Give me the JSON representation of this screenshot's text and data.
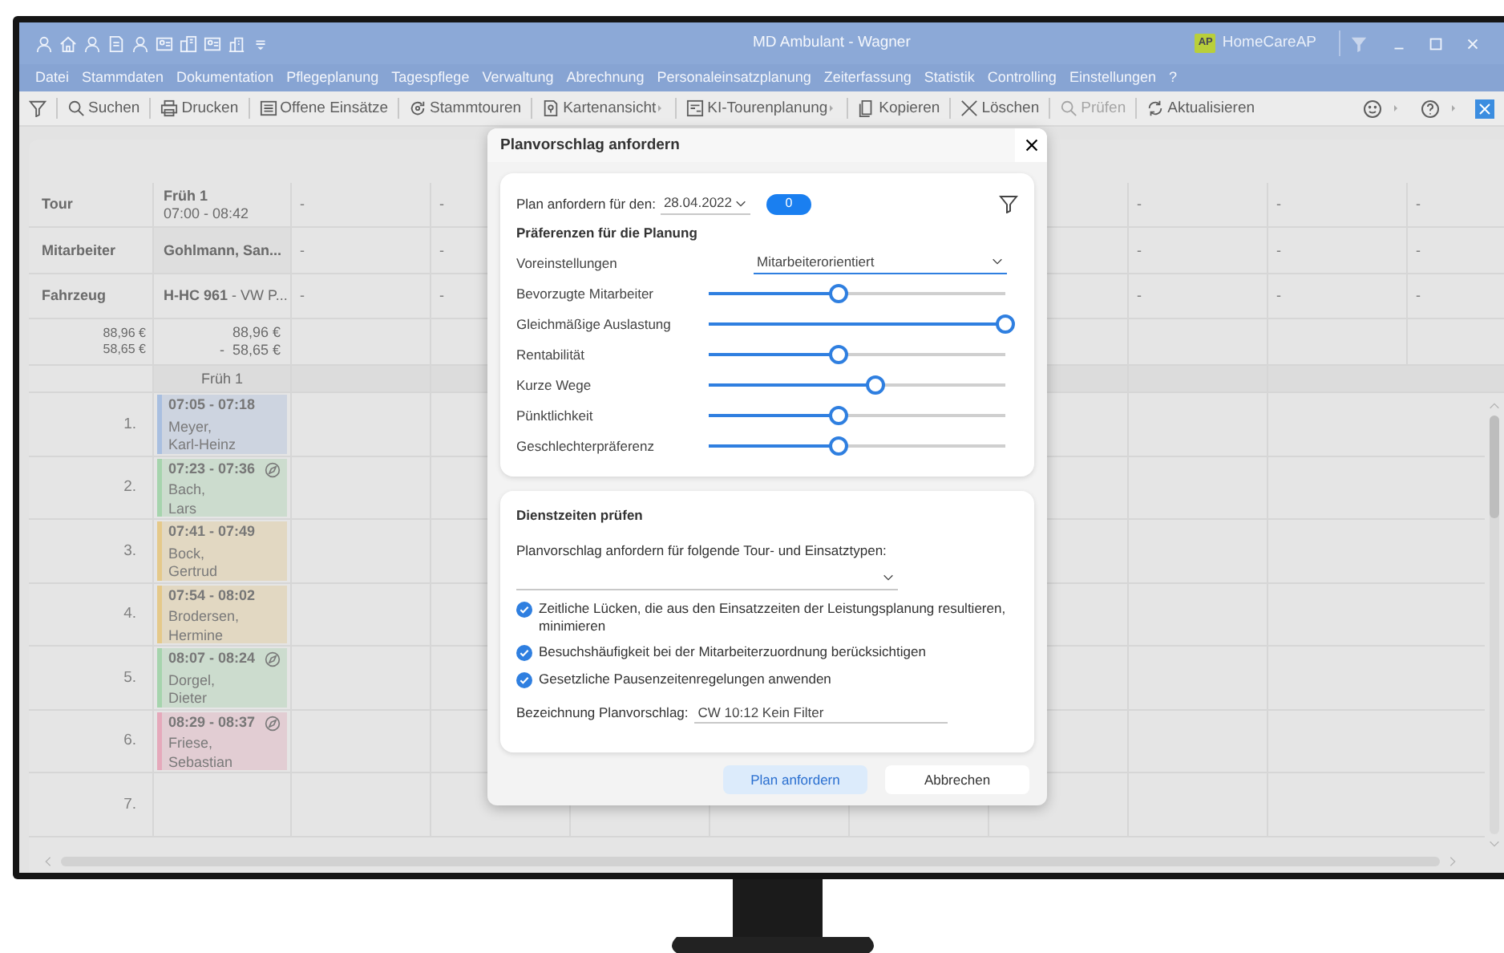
{
  "window": {
    "title": "MD Ambulant  -  Wagner",
    "brand_badge": "AP",
    "brand": "HomeCareAP"
  },
  "menu": [
    "Datei",
    "Stammdaten",
    "Dokumentation",
    "Pflegeplanung",
    "Tagespflege",
    "Verwaltung",
    "Abrechnung",
    "Personaleinsatzplanung",
    "Zeiterfassung",
    "Statistik",
    "Controlling",
    "Einstellungen",
    "?"
  ],
  "toolbar": [
    {
      "label": "Suchen",
      "submenu": false,
      "disabled": false
    },
    {
      "label": "Drucken",
      "submenu": false,
      "disabled": false
    },
    {
      "label": "Offene Einsätze",
      "submenu": false,
      "disabled": false
    },
    {
      "label": "Stammtouren",
      "submenu": false,
      "disabled": false
    },
    {
      "label": "Kartenansicht",
      "submenu": true,
      "disabled": false
    },
    {
      "label": "KI-Tourenplanung",
      "submenu": true,
      "disabled": false
    },
    {
      "label": "Kopieren",
      "submenu": false,
      "disabled": false
    },
    {
      "label": "Löschen",
      "submenu": false,
      "disabled": false
    },
    {
      "label": "Prüfen",
      "submenu": false,
      "disabled": true
    },
    {
      "label": "Aktualisieren",
      "submenu": false,
      "disabled": false
    }
  ],
  "grid": {
    "row_labels": [
      "Tour",
      "Mitarbeiter",
      "Fahrzeug"
    ],
    "totals": [
      "88,96 €",
      "58,65 €"
    ],
    "tour": {
      "name": "Früh 1",
      "time": "07:00 - 08:42",
      "employee": "Gohlmann, San...",
      "vehicle": "**H-HC 961** - VW P...",
      "revenue": "88,96 €",
      "cost": "-  58,65 €",
      "header": "Früh 1"
    },
    "other_tours": [
      {
        "tour": "-",
        "employee": "-",
        "vehicle": "-"
      },
      {
        "tour": "-",
        "employee": "-",
        "vehicle": "-"
      },
      {
        "tour": "-",
        "employee": "-",
        "vehicle": "-"
      },
      {
        "tour": "-",
        "employee": "-",
        "vehicle": "-"
      },
      {
        "tour": "-",
        "employee": "-",
        "vehicle": "-"
      }
    ],
    "slots": [
      {
        "number": "1.",
        "visit": {
          "time": "07:05 - 07:18",
          "name": "Meyer,",
          "first_name": "Karl-Heinz",
          "color": "#a9bfe0",
          "navigation": false
        }
      },
      {
        "number": "2.",
        "visit": {
          "time": "07:23 - 07:36",
          "name": "Bach,",
          "first_name": "Lars",
          "color": "#a6d4ad",
          "navigation": true
        }
      },
      {
        "number": "3.",
        "visit": {
          "time": "07:41 - 07:49",
          "name": "Bock,",
          "first_name": "Gertrud",
          "color": "#e5c98a",
          "navigation": false
        }
      },
      {
        "number": "4.",
        "visit": {
          "time": "07:54 - 08:02",
          "name": "Brodersen,",
          "first_name": "Hermine",
          "color": "#e5c98a",
          "navigation": false
        }
      },
      {
        "number": "5.",
        "visit": {
          "time": "08:07 - 08:24",
          "name": "Dorgel,",
          "first_name": "Dieter",
          "color": "#a6d4ad",
          "navigation": true
        }
      },
      {
        "number": "6.",
        "visit": {
          "time": "08:29 - 08:37",
          "name": "Friese,",
          "first_name": "Sebastian",
          "color": "#e5a9bb",
          "navigation": true
        }
      },
      {
        "number": "7."
      }
    ]
  },
  "dialog": {
    "title": "Planvorschlag anfordern",
    "date_label": "Plan anfordern für den:",
    "date": "28.04.2022",
    "count": "0",
    "preferences_heading": "Präferenzen für die Planung",
    "preset_label": "Voreinstellungen",
    "preset": "Mitarbeiterorientiert",
    "sliders": [
      {
        "label": "Bevorzugte Mitarbeiter",
        "level": 0.44
      },
      {
        "label": "Gleichmäßige Auslastung",
        "level": 1.0
      },
      {
        "label": "Rentabilität",
        "level": 0.44
      },
      {
        "label": "Kurze Wege",
        "level": 0.56
      },
      {
        "label": "Pünktlichkeit",
        "level": 0.44
      },
      {
        "label": "Geschlechterpräferenz",
        "level": 0.44
      }
    ],
    "check_heading": "Dienstzeiten prüfen",
    "types_label": "Planvorschlag anfordern für folgende Tour- und Einsatztypen:",
    "options": [
      {
        "label": "Zeitliche Lücken, die aus den Einsatzzeiten der Leistungsplanung resultieren, minimieren",
        "checked": true
      },
      {
        "label": "Besuchshäufigkeit bei der Mitarbeiterzuordnung berücksichtigen",
        "checked": true
      },
      {
        "label": "Gesetzliche Pausenzeitenregelungen anwenden",
        "checked": true
      }
    ],
    "name_label": "Bezeichnung Planvorschlag:",
    "name_value": "CW 10:12 Kein Filter",
    "buttons": [
      "Plan anfordern",
      "Abbrechen"
    ]
  }
}
